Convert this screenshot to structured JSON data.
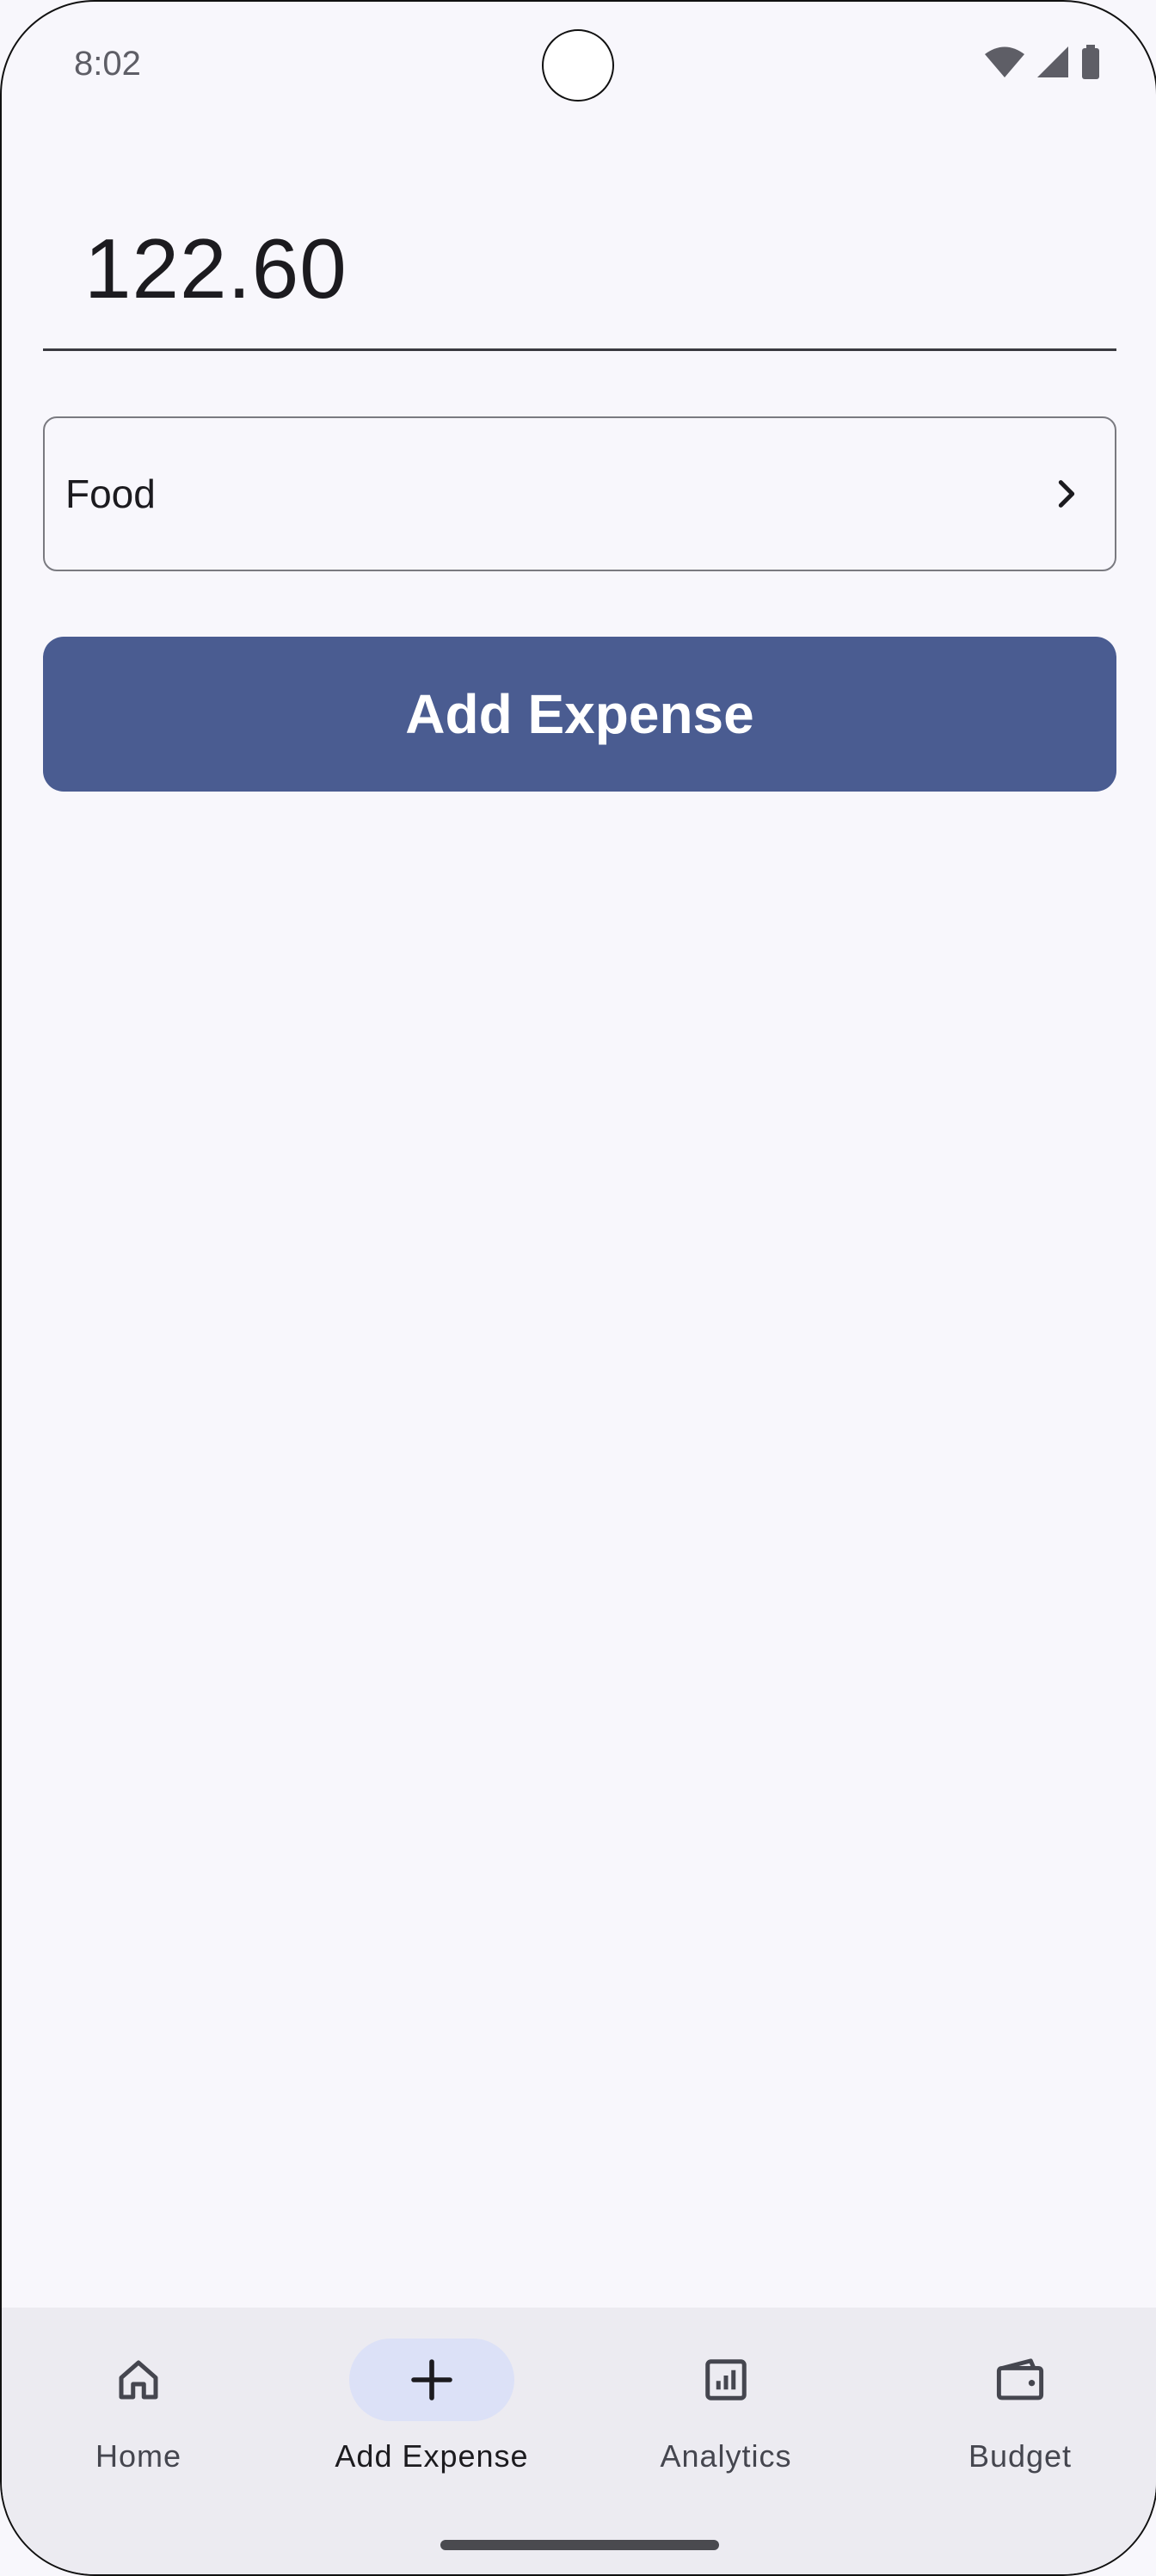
{
  "status_bar": {
    "time": "8:02",
    "icons": [
      "wifi-icon",
      "signal-icon",
      "battery-icon"
    ]
  },
  "form": {
    "amount_value": "122.60",
    "category_label": "Food",
    "submit_label": "Add Expense"
  },
  "bottom_nav": {
    "items": [
      {
        "label": "Home",
        "icon": "home-icon",
        "active": false
      },
      {
        "label": "Add Expense",
        "icon": "plus-icon",
        "active": true
      },
      {
        "label": "Analytics",
        "icon": "analytics-icon",
        "active": false
      },
      {
        "label": "Budget",
        "icon": "wallet-icon",
        "active": false
      }
    ]
  },
  "colors": {
    "background": "#f8f7fc",
    "primary": "#4a5c91",
    "nav_background": "#ecebf1",
    "active_pill": "#dce1f7",
    "text": "#1c1b1f"
  }
}
